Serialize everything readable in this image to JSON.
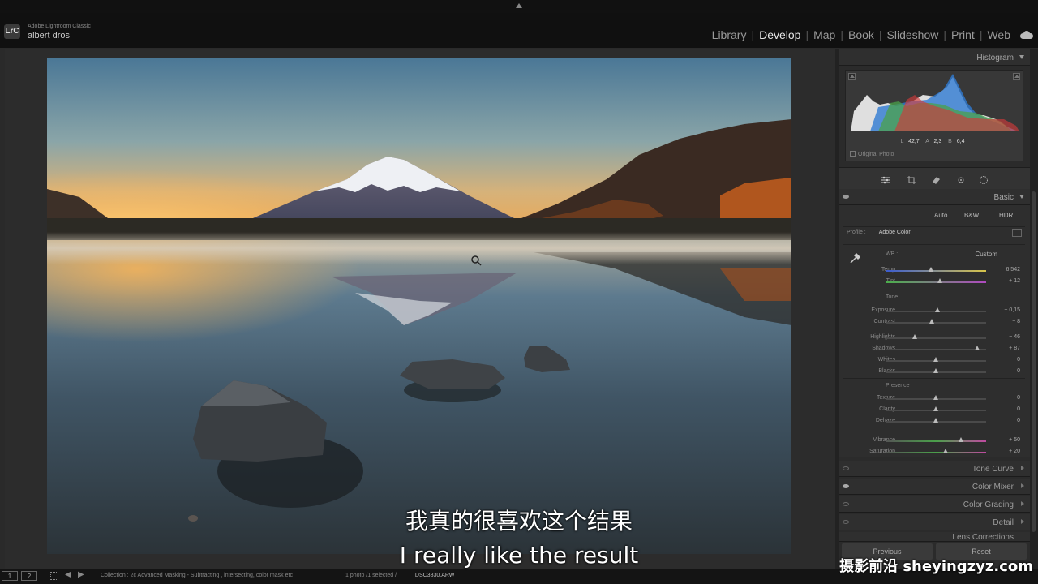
{
  "app": {
    "name": "Adobe Lightroom Classic",
    "logo": "LrC",
    "user": "albert dros"
  },
  "modules": [
    {
      "label": "Library",
      "active": false
    },
    {
      "label": "Develop",
      "active": true
    },
    {
      "label": "Map",
      "active": false
    },
    {
      "label": "Book",
      "active": false
    },
    {
      "label": "Slideshow",
      "active": false
    },
    {
      "label": "Print",
      "active": false
    },
    {
      "label": "Web",
      "active": false
    }
  ],
  "histogram": {
    "title": "Histogram",
    "readout": {
      "L": "42,7",
      "A": "2,3",
      "B": "6,4"
    },
    "original_label": "Original Photo"
  },
  "basic": {
    "title": "Basic",
    "buttons": [
      "Auto",
      "B&W",
      "HDR"
    ],
    "profile_label": "Profile :",
    "profile_value": "Adobe Color",
    "wb_label": "WB :",
    "wb_value": "Custom",
    "sliders": [
      {
        "label": "Temp",
        "value": "6.542",
        "pos": 0.45
      },
      {
        "label": "Tint",
        "value": "+ 12",
        "pos": 0.54
      },
      {
        "label": "Exposure",
        "value": "+ 0,15",
        "pos": 0.52
      },
      {
        "label": "Contrast",
        "value": "− 8",
        "pos": 0.46
      },
      {
        "label": "Highlights",
        "value": "− 46",
        "pos": 0.29
      },
      {
        "label": "Shadows",
        "value": "+ 87",
        "pos": 0.91
      },
      {
        "label": "Whites",
        "value": "0",
        "pos": 0.5
      },
      {
        "label": "Blacks",
        "value": "0",
        "pos": 0.5
      },
      {
        "label": "Texture",
        "value": "0",
        "pos": 0.5
      },
      {
        "label": "Clarity",
        "value": "0",
        "pos": 0.5
      },
      {
        "label": "Dehaze",
        "value": "0",
        "pos": 0.5
      },
      {
        "label": "Vibrance",
        "value": "+ 50",
        "pos": 0.75
      },
      {
        "label": "Saturation",
        "value": "+ 20",
        "pos": 0.6
      }
    ],
    "tone_label": "Tone",
    "presence_label": "Presence"
  },
  "panels": [
    "Tone Curve",
    "Color Mixer",
    "Color Grading",
    "Detail",
    "Lens Corrections"
  ],
  "bottom_buttons": {
    "previous": "Previous",
    "reset": "Reset"
  },
  "filmstrip": {
    "page1": "1",
    "page2": "2",
    "collection": "Collection : 2c Advanced Masking - Subtracting , intersecting, color mask etc",
    "selection": "1 photo /1 selected /",
    "filename": "_DSC3830.ARW"
  },
  "subtitles": {
    "zh": "我真的很喜欢这个结果",
    "en": "I really like the result"
  },
  "watermark": "摄影前沿 sheyingzyz.com"
}
